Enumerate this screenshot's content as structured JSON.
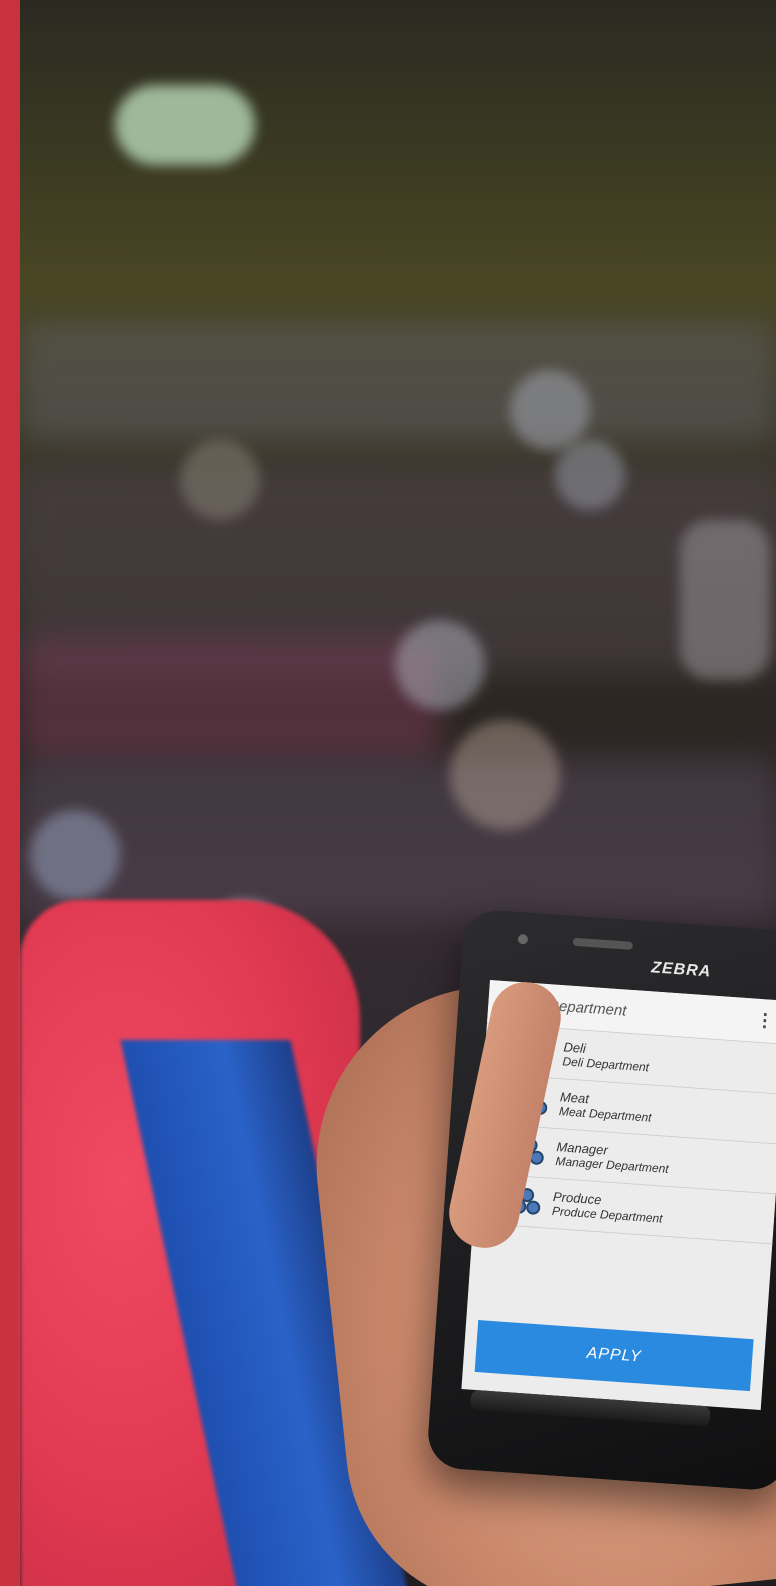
{
  "phone": {
    "brand": "ZEBRA",
    "screen": {
      "title": "Select Department",
      "menu_glyph": "⋮",
      "menu_icon": "overflow-menu-icon",
      "department_icon": "department-icon",
      "departments": [
        {
          "name": "Deli",
          "description": "Deli Department"
        },
        {
          "name": "Meat",
          "description": "Meat Department"
        },
        {
          "name": "Manager",
          "description": "Manager Department"
        },
        {
          "name": "Produce",
          "description": "Produce Department"
        }
      ],
      "apply_label": "APPLY",
      "accent_color": "#2a8ae0"
    }
  },
  "colors": {
    "left_strip": "#c8323f",
    "shirt": "#e23a52",
    "vest": "#2a62c8"
  }
}
